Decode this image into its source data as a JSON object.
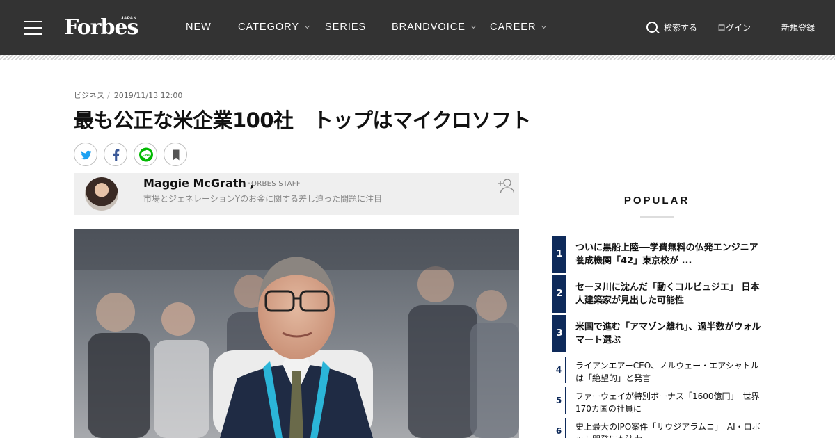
{
  "header": {
    "logo": "Forbes",
    "logo_sub": "JAPAN",
    "nav": [
      {
        "label": "NEW",
        "dropdown": false
      },
      {
        "label": "CATEGORY",
        "dropdown": true
      },
      {
        "label": "SERIES",
        "dropdown": false
      },
      {
        "label": "BRANDVOICE",
        "dropdown": true
      },
      {
        "label": "CAREER",
        "dropdown": true
      }
    ],
    "search_label": "検索する",
    "login_label": "ログイン",
    "register_label": "新規登録",
    "bg_color": "#333333"
  },
  "article": {
    "category": "ビジネス",
    "separator": "/",
    "datetime": "2019/11/13 12:00",
    "title": "最も公正な米企業100社　トップはマイクロソフト",
    "share_icons": [
      "twitter-icon",
      "facebook-icon",
      "line-icon",
      "bookmark-icon"
    ],
    "author": {
      "name": "Maggie McGrath ,",
      "role": "FORBES STAFF",
      "description": "市場とジェネレーションYのお金に関する差し迫った問題に注目"
    }
  },
  "popular": {
    "title": "POPULAR",
    "accent_color": "#0e2a5a",
    "items": [
      {
        "rank": "1",
        "text": "ついに黒船上陸──学費無料の仏発エンジニア養成機関「42」東京校が ..."
      },
      {
        "rank": "2",
        "text": "セーヌ川に沈んだ「動くコルビュジエ」 日本人建築家が見出した可能性"
      },
      {
        "rank": "3",
        "text": "米国で進む「アマゾン離れ」、過半数がウォルマート選ぶ"
      },
      {
        "rank": "4",
        "text": "ライアンエアーCEO、ノルウェー・エアシャトルは「絶望的」と発言"
      },
      {
        "rank": "5",
        "text": "ファーウェイが特別ボーナス「1600億円」　世界170カ国の社員に"
      },
      {
        "rank": "6",
        "text": "史上最大のIPO案件「サウジアラムコ」　AI・ロボット開発にも注力"
      }
    ]
  }
}
